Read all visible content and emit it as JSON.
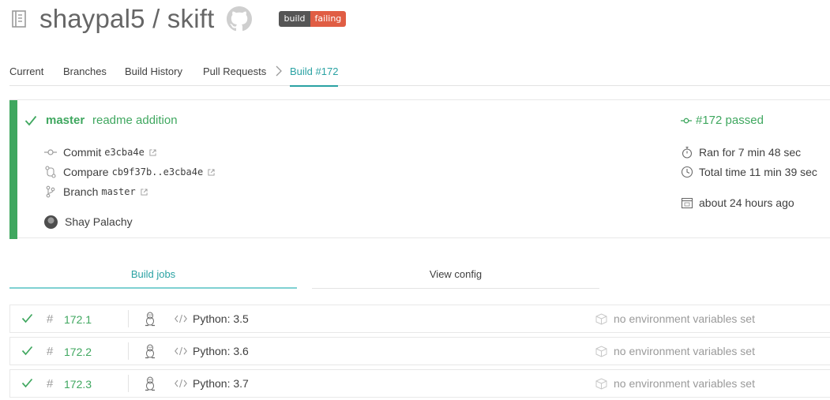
{
  "repo": {
    "title": "shaypal5 / skift",
    "repo_icon": "repo-book-icon",
    "github_icon": "github-octocat-icon",
    "badge": {
      "left": "build",
      "right": "failing",
      "left_color": "#555555",
      "right_color": "#e05d44"
    }
  },
  "tabs": [
    {
      "label": "Current",
      "active": false
    },
    {
      "label": "Branches",
      "active": false
    },
    {
      "label": "Build History",
      "active": false
    },
    {
      "label": "Pull Requests",
      "active": false
    },
    {
      "label": "Build #172",
      "active": true
    }
  ],
  "build": {
    "status_color": "#3fa75f",
    "branch": "master",
    "message": "readme addition",
    "commit_label": "Commit",
    "commit_hash": "e3cba4e",
    "compare_label": "Compare",
    "compare_range": "cb9f37b..e3cba4e",
    "branch_label": "Branch",
    "branch_value": "master",
    "author": "Shay Palachy",
    "status_text": "#172 passed",
    "ran_for": "Ran for 7 min 48 sec",
    "total_time": "Total time 11 min 39 sec",
    "finished": "about 24 hours ago"
  },
  "sub_tabs": {
    "build_jobs": "Build jobs",
    "view_config": "View config"
  },
  "jobs": [
    {
      "hash": "#",
      "number": "172.1",
      "os_icon": "linux-tux-icon",
      "language": "Python: 3.5",
      "env": "no environment variables set"
    },
    {
      "hash": "#",
      "number": "172.2",
      "os_icon": "linux-tux-icon",
      "language": "Python: 3.6",
      "env": "no environment variables set"
    },
    {
      "hash": "#",
      "number": "172.3",
      "os_icon": "linux-tux-icon",
      "language": "Python: 3.7",
      "env": "no environment variables set"
    }
  ]
}
